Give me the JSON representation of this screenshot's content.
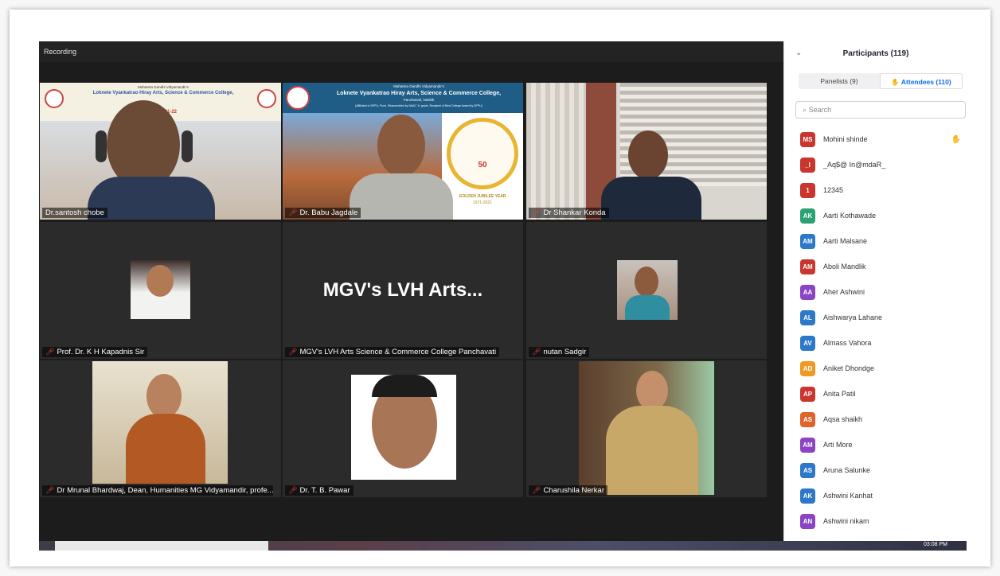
{
  "meeting": {
    "recording_label": "Recording"
  },
  "banner": {
    "org": "Mahatma Gandhi Vidyamandir's",
    "college": "Loknete Vyankatrao Hiray Arts, Science & Commerce College,",
    "place": "Panchavati, Nashik",
    "small": "(Affiliated to SPPU, Pune, Reaccredited by NAAC 'A' grade, Recipient of Best College Award by SPPU)",
    "year_short": "2021-22",
    "jubilee": "GOLDEN JUBILEE YEAR",
    "jubilee_years": "1971-2021",
    "fifty": "50"
  },
  "tiles": [
    {
      "name": "Dr.santosh chobe",
      "muted": false
    },
    {
      "name": "Dr. Babu Jagdale",
      "muted": true
    },
    {
      "name": "Dr Shankar Konda",
      "muted": true
    },
    {
      "name": "Prof. Dr. K H Kapadnis Sir",
      "muted": true
    },
    {
      "name": "MGV's LVH Arts Science & Commerce College Panchavati",
      "muted": true,
      "display": "MGV's LVH Arts..."
    },
    {
      "name": "nutan Sadgir",
      "muted": true
    },
    {
      "name": "Dr Mrunal Bhardwaj, Dean, Humanities MG Vidyamandir, profe...",
      "muted": true
    },
    {
      "name": "Dr. T. B. Pawar",
      "muted": true
    },
    {
      "name": "Charushila Nerkar",
      "muted": true
    }
  ],
  "panel": {
    "title": "Participants (119)",
    "tab_panelists": "Panelists (9)",
    "tab_attendees": "Attendees (110)",
    "search_placeholder": "Search",
    "participants": [
      {
        "initials": "MS",
        "name": "Mohini shinde",
        "color": "#c9362e",
        "hand": true
      },
      {
        "initials": "_I",
        "name": "_Aq$@ In@mdaR_",
        "color": "#c9362e",
        "hand": false
      },
      {
        "initials": "1",
        "name": "12345",
        "color": "#c9362e",
        "hand": false
      },
      {
        "initials": "AK",
        "name": "Aarti Kothawade",
        "color": "#2aa276",
        "hand": false
      },
      {
        "initials": "AM",
        "name": "Aarti Malsane",
        "color": "#2d78c8",
        "hand": false
      },
      {
        "initials": "AM",
        "name": "Aboli Mandlik",
        "color": "#c9362e",
        "hand": false
      },
      {
        "initials": "AA",
        "name": "Aher Ashwini",
        "color": "#8b45c4",
        "hand": false
      },
      {
        "initials": "AL",
        "name": "Aishwarya Lahane",
        "color": "#2d78c8",
        "hand": false
      },
      {
        "initials": "AV",
        "name": "Almass Vahora",
        "color": "#2d78c8",
        "hand": false
      },
      {
        "initials": "AD",
        "name": "Aniket Dhondge",
        "color": "#ee9a24",
        "hand": false
      },
      {
        "initials": "AP",
        "name": "Anita Patil",
        "color": "#c9362e",
        "hand": false
      },
      {
        "initials": "AS",
        "name": "Aqsa shaikh",
        "color": "#e0642a",
        "hand": false
      },
      {
        "initials": "AM",
        "name": "Arti More",
        "color": "#8b45c4",
        "hand": false
      },
      {
        "initials": "AS",
        "name": "Aruna Salunke",
        "color": "#2d78c8",
        "hand": false
      },
      {
        "initials": "AK",
        "name": "Ashwini Kanhat",
        "color": "#2d78c8",
        "hand": false
      },
      {
        "initials": "AN",
        "name": "Ashwini nikam",
        "color": "#8b45c4",
        "hand": false
      }
    ]
  },
  "taskbar": {
    "time": "03:08 PM"
  }
}
